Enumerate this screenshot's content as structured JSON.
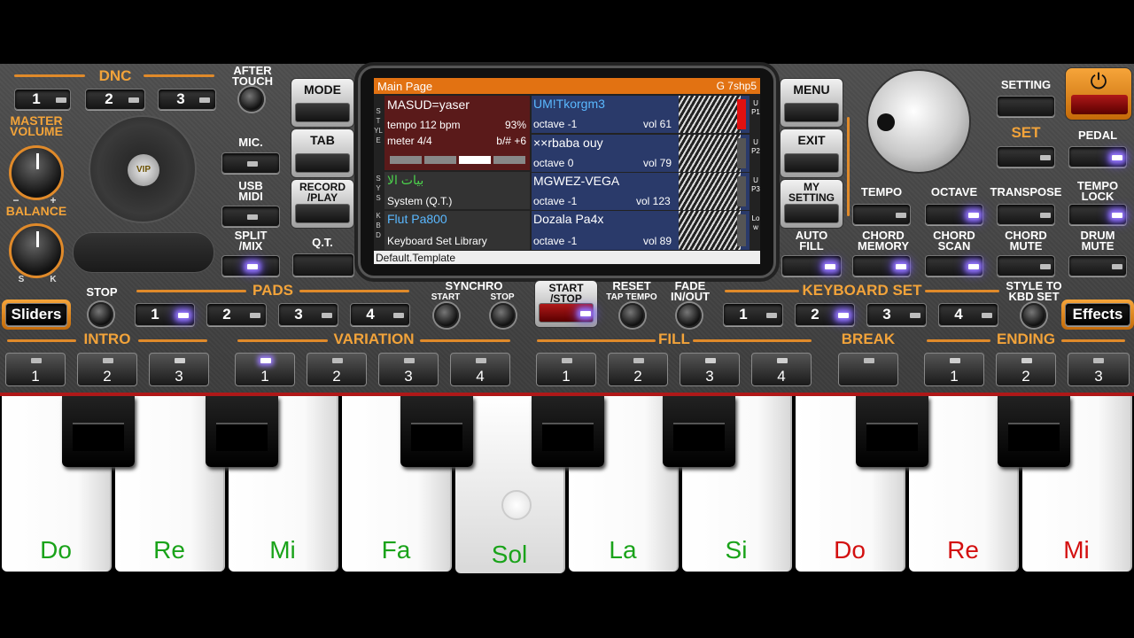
{
  "colors": {
    "accent_orange": "#f2a33a",
    "green_note": "#1aa31a",
    "red_note": "#d31010",
    "screen_header": "#e27212"
  },
  "left": {
    "dnc": "DNC",
    "after_touch": "AFTER\nTOUCH",
    "dnc_buttons": [
      "1",
      "2",
      "3"
    ],
    "master_volume": "MASTER\nVOLUME",
    "balance": "BALANCE",
    "balance_left": "S",
    "balance_right": "K",
    "minus": "−",
    "plus": "+",
    "mic": "MIC.",
    "usb_midi": "USB\nMIDI",
    "split_mix": "SPLIT\n/MIX",
    "logo": "VIP"
  },
  "mode": {
    "mode": "MODE",
    "tab": "TAB",
    "record_play": "RECORD\n/PLAY",
    "qt": "Q.T."
  },
  "screen": {
    "title": "Main Page",
    "code": "G 7shp5",
    "style_name": "MASUD=yaser",
    "tempo": "tempo 112 bpm",
    "tempo_pct": "93%",
    "meter": "meter 4/4",
    "key_shift": "b/# +6",
    "sys_name": "بيات الا",
    "sys_sub": "System (Q.T.)",
    "kbd_name": "Flut Pa800",
    "kbd_sub": "Keyboard Set Library",
    "footer": "Default.Template",
    "side_style": "STYLE",
    "side_sys": "SYS",
    "side_kbd": "KBD",
    "upper": [
      {
        "name": "UM!Tkorgm3",
        "octave": "octave -1",
        "vol": "vol 61",
        "tag": "UP1"
      },
      {
        "name": "××rbaba ouy",
        "octave": "octave  0",
        "vol": "vol 79",
        "tag": "UP2"
      },
      {
        "name": "MGWEZ-VEGA",
        "octave": "octave -1",
        "vol": "vol 123",
        "tag": "UP3"
      },
      {
        "name": "Dozala Pa4x",
        "octave": "octave -1",
        "vol": "vol 89",
        "tag": "Low"
      }
    ]
  },
  "right": {
    "menu": "MENU",
    "exit": "EXIT",
    "my_setting": "MY\nSETTING",
    "auto_fill": "AUTO\nFILL",
    "setting": "SETTING",
    "set": "SET",
    "pedal": "PEDAL",
    "tempo": "TEMPO",
    "octave": "OCTAVE",
    "transpose": "TRANSPOSE",
    "tempo_lock": "TEMPO\nLOCK",
    "chord_memory": "CHORD\nMEMORY",
    "chord_scan": "CHORD\nSCAN",
    "chord_mute": "CHORD\nMUTE",
    "drum_mute": "DRUM\nMUTE",
    "power": "⏻"
  },
  "middle": {
    "sliders": "Sliders",
    "stop": "STOP",
    "pads": "PADS",
    "pad_buttons": [
      "1",
      "2",
      "3",
      "4"
    ],
    "synchro": "SYNCHRO",
    "start": "START",
    "stop2": "STOP",
    "start_stop": "START\n/STOP",
    "reset": "RESET",
    "tap_tempo": "TAP TEMPO",
    "fade": "FADE\nIN/OUT",
    "keyboard_set": "KEYBOARD SET",
    "kbd_buttons": [
      "1",
      "2",
      "3",
      "4"
    ],
    "style_to_kbd": "STYLE TO\nKBD SET",
    "effects": "Effects"
  },
  "sections": {
    "intro": "INTRO",
    "variation": "VARIATION",
    "fill": "FILL",
    "break": "BREAK",
    "ending": "ENDING",
    "intro_buttons": [
      "1",
      "2",
      "3"
    ],
    "variation_buttons": [
      "1",
      "2",
      "3",
      "4"
    ],
    "fill_buttons": [
      "1",
      "2",
      "3",
      "4"
    ],
    "ending_buttons": [
      "1",
      "2",
      "3"
    ]
  },
  "keys": [
    "Do",
    "Re",
    "Mi",
    "Fa",
    "Sol",
    "La",
    "Si",
    "Do",
    "Re",
    "Mi"
  ]
}
